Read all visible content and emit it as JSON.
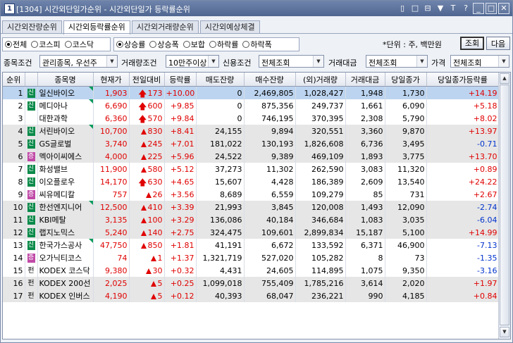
{
  "window": {
    "number": "1",
    "title": "[1304] 시간외단일가순위 - 시간외단일가 등락률순위",
    "buttons": [
      "▯",
      "□",
      "⊟",
      "▼",
      "T",
      "?",
      "_",
      "□",
      "✕"
    ]
  },
  "tabs": [
    {
      "label": "시간외잔량순위",
      "active": false
    },
    {
      "label": "시간외등락률순위",
      "active": true
    },
    {
      "label": "시간외거래량순위",
      "active": false
    },
    {
      "label": "시간외예상체결",
      "active": false
    }
  ],
  "market_filter": [
    {
      "label": "전체",
      "checked": true
    },
    {
      "label": "코스피",
      "checked": false
    },
    {
      "label": "코스닥",
      "checked": false
    }
  ],
  "change_filter": [
    {
      "label": "상승률",
      "checked": true
    },
    {
      "label": "상승폭",
      "checked": false
    },
    {
      "label": "보합",
      "checked": false
    },
    {
      "label": "하락률",
      "checked": false
    },
    {
      "label": "하락폭",
      "checked": false
    }
  ],
  "unit_text": "*단위 : 주, 백만원",
  "query_button": "조회",
  "next_button": "다음",
  "conditions": {
    "stock_label": "종목조건",
    "stock_value": "관리종목, 우선주",
    "volume_label": "거래량조건",
    "volume_value": "10만주이상",
    "credit_label": "신용조건",
    "credit_value": "전체조회",
    "amount_label": "거래대금",
    "amount_value": "전체조회",
    "price_label": "가격",
    "price_value": "전체조회"
  },
  "columns": [
    "순위",
    "",
    "종목명",
    "현재가",
    "전일대비",
    "등락률",
    "매도잔량",
    "매수잔량",
    "(외)거래량",
    "거래대금",
    "당일종가",
    "당일종가등락률"
  ],
  "rows": [
    {
      "rank": "1",
      "badge": "신",
      "bc": "#0a8a4a",
      "name": "일신바이오",
      "tri": true,
      "price": "1,903",
      "arrow": "big",
      "change": "173",
      "rate": "+10.00",
      "sell": "0",
      "buy": "2,469,805",
      "vol": "1,028,427",
      "amt": "1,948",
      "close": "1,730",
      "crate": "+14.19",
      "cdir": "up"
    },
    {
      "rank": "2",
      "badge": "신",
      "bc": "#0a8a4a",
      "name": "메디아나",
      "tri": true,
      "price": "6,690",
      "arrow": "big",
      "change": "600",
      "rate": "+9.85",
      "sell": "0",
      "buy": "875,356",
      "vol": "249,737",
      "amt": "1,661",
      "close": "6,090",
      "crate": "+5.18",
      "cdir": "up"
    },
    {
      "rank": "3",
      "badge": "",
      "bc": "",
      "name": "대한과학",
      "tri": false,
      "price": "6,360",
      "arrow": "big",
      "change": "570",
      "rate": "+9.84",
      "sell": "0",
      "buy": "746,195",
      "vol": "370,395",
      "amt": "2,308",
      "close": "5,790",
      "crate": "+8.02",
      "cdir": "up"
    },
    {
      "rank": "4",
      "badge": "신",
      "bc": "#0a8a4a",
      "name": "서린바이오",
      "tri": true,
      "price": "10,700",
      "arrow": "tri",
      "change": "830",
      "rate": "+8.41",
      "sell": "24,155",
      "buy": "9,894",
      "vol": "320,551",
      "amt": "3,360",
      "close": "9,870",
      "crate": "+13.97",
      "cdir": "up"
    },
    {
      "rank": "5",
      "badge": "신",
      "bc": "#0a8a4a",
      "name": "GS글로벌",
      "tri": false,
      "price": "3,740",
      "arrow": "tri",
      "change": "245",
      "rate": "+7.01",
      "sell": "181,022",
      "buy": "130,193",
      "vol": "1,826,608",
      "amt": "6,736",
      "close": "3,495",
      "crate": "-0.71",
      "cdir": "dn"
    },
    {
      "rank": "6",
      "badge": "증",
      "bc": "#c04aa8",
      "name": "멕아이씨에스",
      "tri": false,
      "price": "4,000",
      "arrow": "tri",
      "change": "225",
      "rate": "+5.96",
      "sell": "24,522",
      "buy": "9,389",
      "vol": "469,109",
      "amt": "1,893",
      "close": "3,775",
      "crate": "+13.70",
      "cdir": "up"
    },
    {
      "rank": "7",
      "badge": "신",
      "bc": "#0a8a4a",
      "name": "화성밸브",
      "tri": false,
      "price": "11,900",
      "arrow": "tri",
      "change": "580",
      "rate": "+5.12",
      "sell": "37,273",
      "buy": "11,302",
      "vol": "262,590",
      "amt": "3,083",
      "close": "11,320",
      "crate": "+0.89",
      "cdir": "up"
    },
    {
      "rank": "8",
      "badge": "신",
      "bc": "#0a8a4a",
      "name": "이오플로우",
      "tri": false,
      "price": "14,170",
      "arrow": "big",
      "change": "630",
      "rate": "+4.65",
      "sell": "15,607",
      "buy": "4,428",
      "vol": "186,389",
      "amt": "2,609",
      "close": "13,540",
      "crate": "+24.22",
      "cdir": "up"
    },
    {
      "rank": "9",
      "badge": "증",
      "bc": "#c04aa8",
      "name": "씨유메디칼",
      "tri": false,
      "price": "757",
      "arrow": "tri",
      "change": "26",
      "rate": "+3.56",
      "sell": "8,689",
      "buy": "6,559",
      "vol": "109,279",
      "amt": "85",
      "close": "731",
      "crate": "+2.67",
      "cdir": "up"
    },
    {
      "rank": "10",
      "badge": "신",
      "bc": "#0a8a4a",
      "name": "한선엔지니어",
      "tri": true,
      "price": "12,500",
      "arrow": "tri",
      "change": "410",
      "rate": "+3.39",
      "sell": "21,993",
      "buy": "3,845",
      "vol": "120,008",
      "amt": "1,493",
      "close": "12,090",
      "crate": "-2.74",
      "cdir": "dn"
    },
    {
      "rank": "11",
      "badge": "신",
      "bc": "#0a8a4a",
      "name": "KBI메탈",
      "tri": false,
      "price": "3,135",
      "arrow": "tri",
      "change": "100",
      "rate": "+3.29",
      "sell": "136,086",
      "buy": "40,184",
      "vol": "346,684",
      "amt": "1,083",
      "close": "3,035",
      "crate": "-6.04",
      "cdir": "dn"
    },
    {
      "rank": "12",
      "badge": "신",
      "bc": "#0a8a4a",
      "name": "랩지노믹스",
      "tri": false,
      "price": "5,240",
      "arrow": "tri",
      "change": "140",
      "rate": "+2.75",
      "sell": "324,475",
      "buy": "109,601",
      "vol": "2,899,834",
      "amt": "15,187",
      "close": "5,100",
      "crate": "+14.99",
      "cdir": "up"
    },
    {
      "rank": "13",
      "badge": "신",
      "bc": "#0a8a4a",
      "name": "한국가스공사",
      "tri": true,
      "price": "47,750",
      "arrow": "tri",
      "change": "850",
      "rate": "+1.81",
      "sell": "41,191",
      "buy": "6,672",
      "vol": "133,592",
      "amt": "6,371",
      "close": "46,900",
      "crate": "-7.13",
      "cdir": "dn"
    },
    {
      "rank": "14",
      "badge": "증",
      "bc": "#c04aa8",
      "name": "오가닉티코스",
      "tri": false,
      "price": "74",
      "arrow": "tri",
      "change": "1",
      "rate": "+1.37",
      "sell": "1,321,719",
      "buy": "527,020",
      "vol": "105,282",
      "amt": "8",
      "close": "73",
      "crate": "-1.35",
      "cdir": "dn"
    },
    {
      "rank": "15",
      "badge": "펀",
      "bc": "",
      "name": "KODEX 코스닥",
      "tri": false,
      "price": "9,380",
      "arrow": "tri",
      "change": "30",
      "rate": "+0.32",
      "sell": "4,431",
      "buy": "24,605",
      "vol": "114,895",
      "amt": "1,075",
      "close": "9,350",
      "crate": "-3.16",
      "cdir": "dn"
    },
    {
      "rank": "16",
      "badge": "펀",
      "bc": "",
      "name": "KODEX 200선",
      "tri": false,
      "price": "2,025",
      "arrow": "tri",
      "change": "5",
      "rate": "+0.25",
      "sell": "1,099,018",
      "buy": "755,409",
      "vol": "1,785,216",
      "amt": "3,614",
      "close": "2,020",
      "crate": "+1.97",
      "cdir": "up"
    },
    {
      "rank": "17",
      "badge": "펀",
      "bc": "",
      "name": "KODEX 인버스",
      "tri": false,
      "price": "4,190",
      "arrow": "tri",
      "change": "5",
      "rate": "+0.12",
      "sell": "40,393",
      "buy": "68,047",
      "vol": "236,221",
      "amt": "990",
      "close": "4,185",
      "crate": "+0.84",
      "cdir": "up"
    }
  ]
}
